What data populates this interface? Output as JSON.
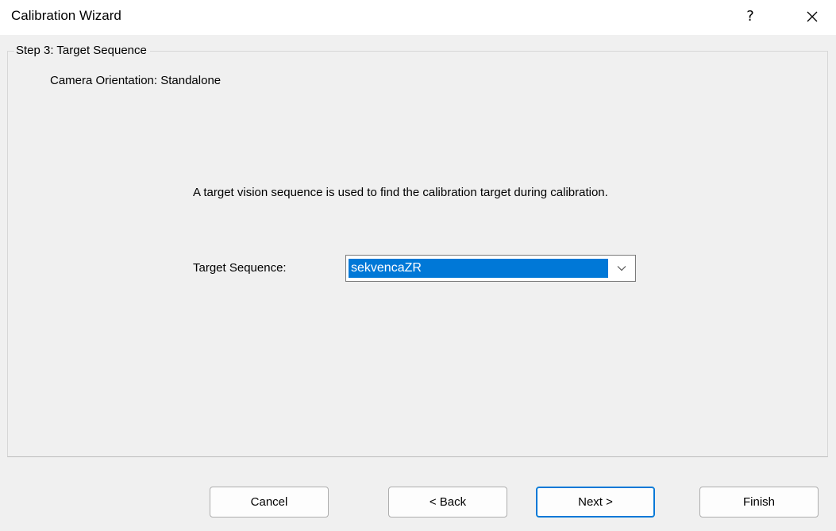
{
  "window": {
    "title": "Calibration Wizard",
    "help_glyph": "?",
    "close_icon": "close-icon"
  },
  "step": {
    "legend": "Step 3: Target Sequence",
    "orientation": "Camera Orientation: Standalone"
  },
  "main": {
    "description": "A target vision sequence is used to find the calibration target during calibration.",
    "sequence_label": "Target Sequence:",
    "sequence_value": "sekvencaZR",
    "dropdown_icon": "chevron-down-icon"
  },
  "buttons": {
    "cancel": "Cancel",
    "back": "< Back",
    "next": "Next >",
    "finish": "Finish"
  },
  "colors": {
    "selection": "#0078d7",
    "background": "#f0f0f0",
    "titlebar": "#ffffff"
  }
}
